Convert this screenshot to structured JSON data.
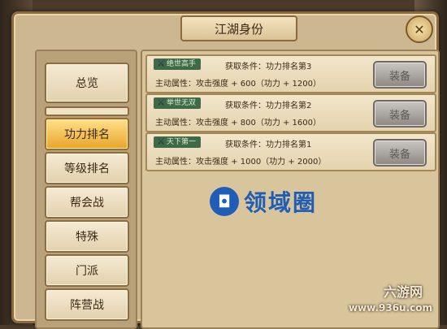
{
  "window": {
    "title": "江湖身份",
    "close_icon": "close-icon"
  },
  "sidebar": {
    "items": [
      {
        "label": "总览"
      },
      {
        "label": "功力排名",
        "active": true
      },
      {
        "label": "等级排名"
      },
      {
        "label": "帮会战"
      },
      {
        "label": "特殊"
      },
      {
        "label": "门派"
      },
      {
        "label": "阵营战"
      }
    ]
  },
  "titles": [
    {
      "badge": "绝世高手",
      "condition": "获取条件：功力排名第3",
      "attribute": "主动属性：攻击强度 + 600（功力 + 1200）",
      "button": "装备"
    },
    {
      "badge": "举世无双",
      "condition": "获取条件：功力排名第2",
      "attribute": "主动属性：攻击强度 + 800（功力 + 1600）",
      "button": "装备"
    },
    {
      "badge": "天下第一",
      "condition": "获取条件：功力排名第1",
      "attribute": "主动属性：攻击强度 + 1000（功力 + 2000）",
      "button": "装备"
    }
  ],
  "watermark": {
    "text": "领域圈"
  },
  "site": {
    "logo": "六游网",
    "url": "www.936u.com"
  },
  "colors": {
    "active_tab": "#e9a528",
    "badge_bg": "#3f6a4a",
    "button_disabled": "#8c8984"
  }
}
